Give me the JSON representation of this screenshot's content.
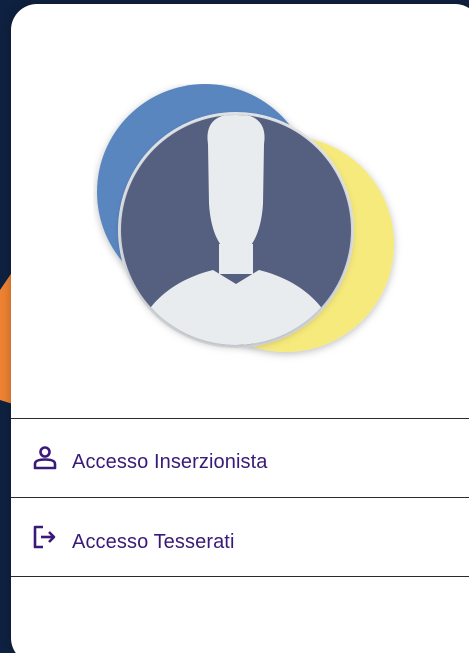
{
  "menu": {
    "items": [
      {
        "label": "Accesso Inserzionista",
        "icon": "user-icon"
      },
      {
        "label": "Accesso Tesserati",
        "icon": "sign-in-icon"
      }
    ]
  },
  "colors": {
    "accent_text": "#3a1a78",
    "icon_color": "#3a1a78",
    "avatar_blue": "#5a86c0",
    "avatar_yellow": "#f6ea7c",
    "avatar_slate": "#546080",
    "arrow_orange": "#ee8232",
    "background_dark": "#0f2140"
  }
}
